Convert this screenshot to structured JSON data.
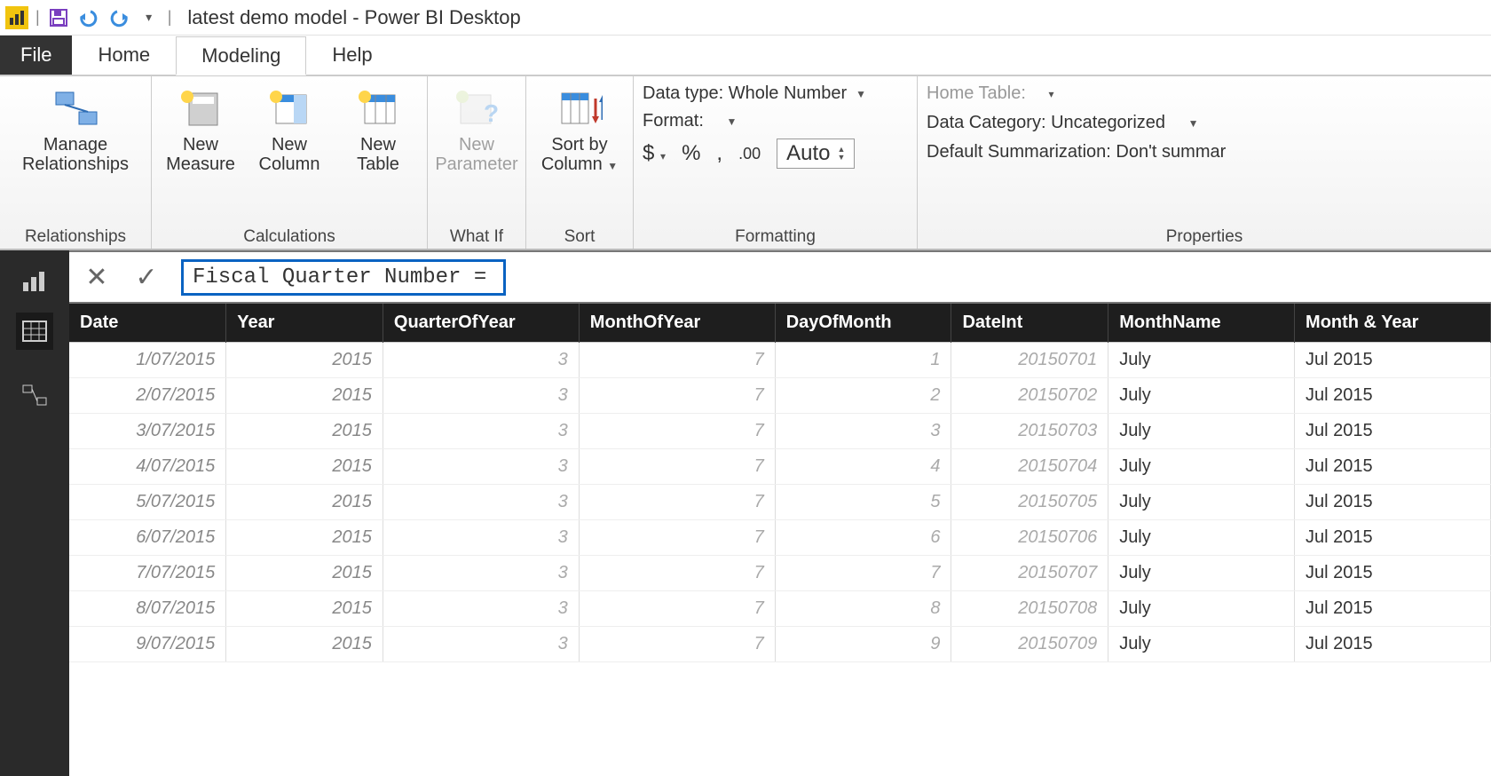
{
  "title": "latest demo model - Power BI Desktop",
  "tabs": {
    "file": "File",
    "home": "Home",
    "modeling": "Modeling",
    "help": "Help"
  },
  "ribbon": {
    "relationships": {
      "manage": "Manage\nRelationships",
      "group": "Relationships"
    },
    "calculations": {
      "newMeasure": "New\nMeasure",
      "newColumn": "New\nColumn",
      "newTable": "New\nTable",
      "group": "Calculations"
    },
    "whatif": {
      "newParameter": "New\nParameter",
      "group": "What If"
    },
    "sort": {
      "sortBy": "Sort by\nColumn",
      "group": "Sort"
    },
    "formatting": {
      "dataType": "Data type: Whole Number",
      "format": "Format:",
      "currency": "$",
      "percent": "%",
      "thousand": ",",
      "decimals": ".00",
      "auto": "Auto",
      "group": "Formatting"
    },
    "properties": {
      "homeTable": "Home Table:",
      "dataCategory": "Data Category: Uncategorized",
      "defaultSumm": "Default Summarization: Don't summar",
      "group": "Properties"
    }
  },
  "formula": {
    "value": "Fiscal Quarter Number = "
  },
  "grid": {
    "columns": [
      "Date",
      "Year",
      "QuarterOfYear",
      "MonthOfYear",
      "DayOfMonth",
      "DateInt",
      "MonthName",
      "Month & Year"
    ],
    "rows": [
      {
        "Date": "1/07/2015",
        "Year": "2015",
        "QuarterOfYear": "3",
        "MonthOfYear": "7",
        "DayOfMonth": "1",
        "DateInt": "20150701",
        "MonthName": "July",
        "MonthYear": "Jul 2015"
      },
      {
        "Date": "2/07/2015",
        "Year": "2015",
        "QuarterOfYear": "3",
        "MonthOfYear": "7",
        "DayOfMonth": "2",
        "DateInt": "20150702",
        "MonthName": "July",
        "MonthYear": "Jul 2015"
      },
      {
        "Date": "3/07/2015",
        "Year": "2015",
        "QuarterOfYear": "3",
        "MonthOfYear": "7",
        "DayOfMonth": "3",
        "DateInt": "20150703",
        "MonthName": "July",
        "MonthYear": "Jul 2015"
      },
      {
        "Date": "4/07/2015",
        "Year": "2015",
        "QuarterOfYear": "3",
        "MonthOfYear": "7",
        "DayOfMonth": "4",
        "DateInt": "20150704",
        "MonthName": "July",
        "MonthYear": "Jul 2015"
      },
      {
        "Date": "5/07/2015",
        "Year": "2015",
        "QuarterOfYear": "3",
        "MonthOfYear": "7",
        "DayOfMonth": "5",
        "DateInt": "20150705",
        "MonthName": "July",
        "MonthYear": "Jul 2015"
      },
      {
        "Date": "6/07/2015",
        "Year": "2015",
        "QuarterOfYear": "3",
        "MonthOfYear": "7",
        "DayOfMonth": "6",
        "DateInt": "20150706",
        "MonthName": "July",
        "MonthYear": "Jul 2015"
      },
      {
        "Date": "7/07/2015",
        "Year": "2015",
        "QuarterOfYear": "3",
        "MonthOfYear": "7",
        "DayOfMonth": "7",
        "DateInt": "20150707",
        "MonthName": "July",
        "MonthYear": "Jul 2015"
      },
      {
        "Date": "8/07/2015",
        "Year": "2015",
        "QuarterOfYear": "3",
        "MonthOfYear": "7",
        "DayOfMonth": "8",
        "DateInt": "20150708",
        "MonthName": "July",
        "MonthYear": "Jul 2015"
      },
      {
        "Date": "9/07/2015",
        "Year": "2015",
        "QuarterOfYear": "3",
        "MonthOfYear": "7",
        "DayOfMonth": "9",
        "DateInt": "20150709",
        "MonthName": "July",
        "MonthYear": "Jul 2015"
      }
    ]
  }
}
